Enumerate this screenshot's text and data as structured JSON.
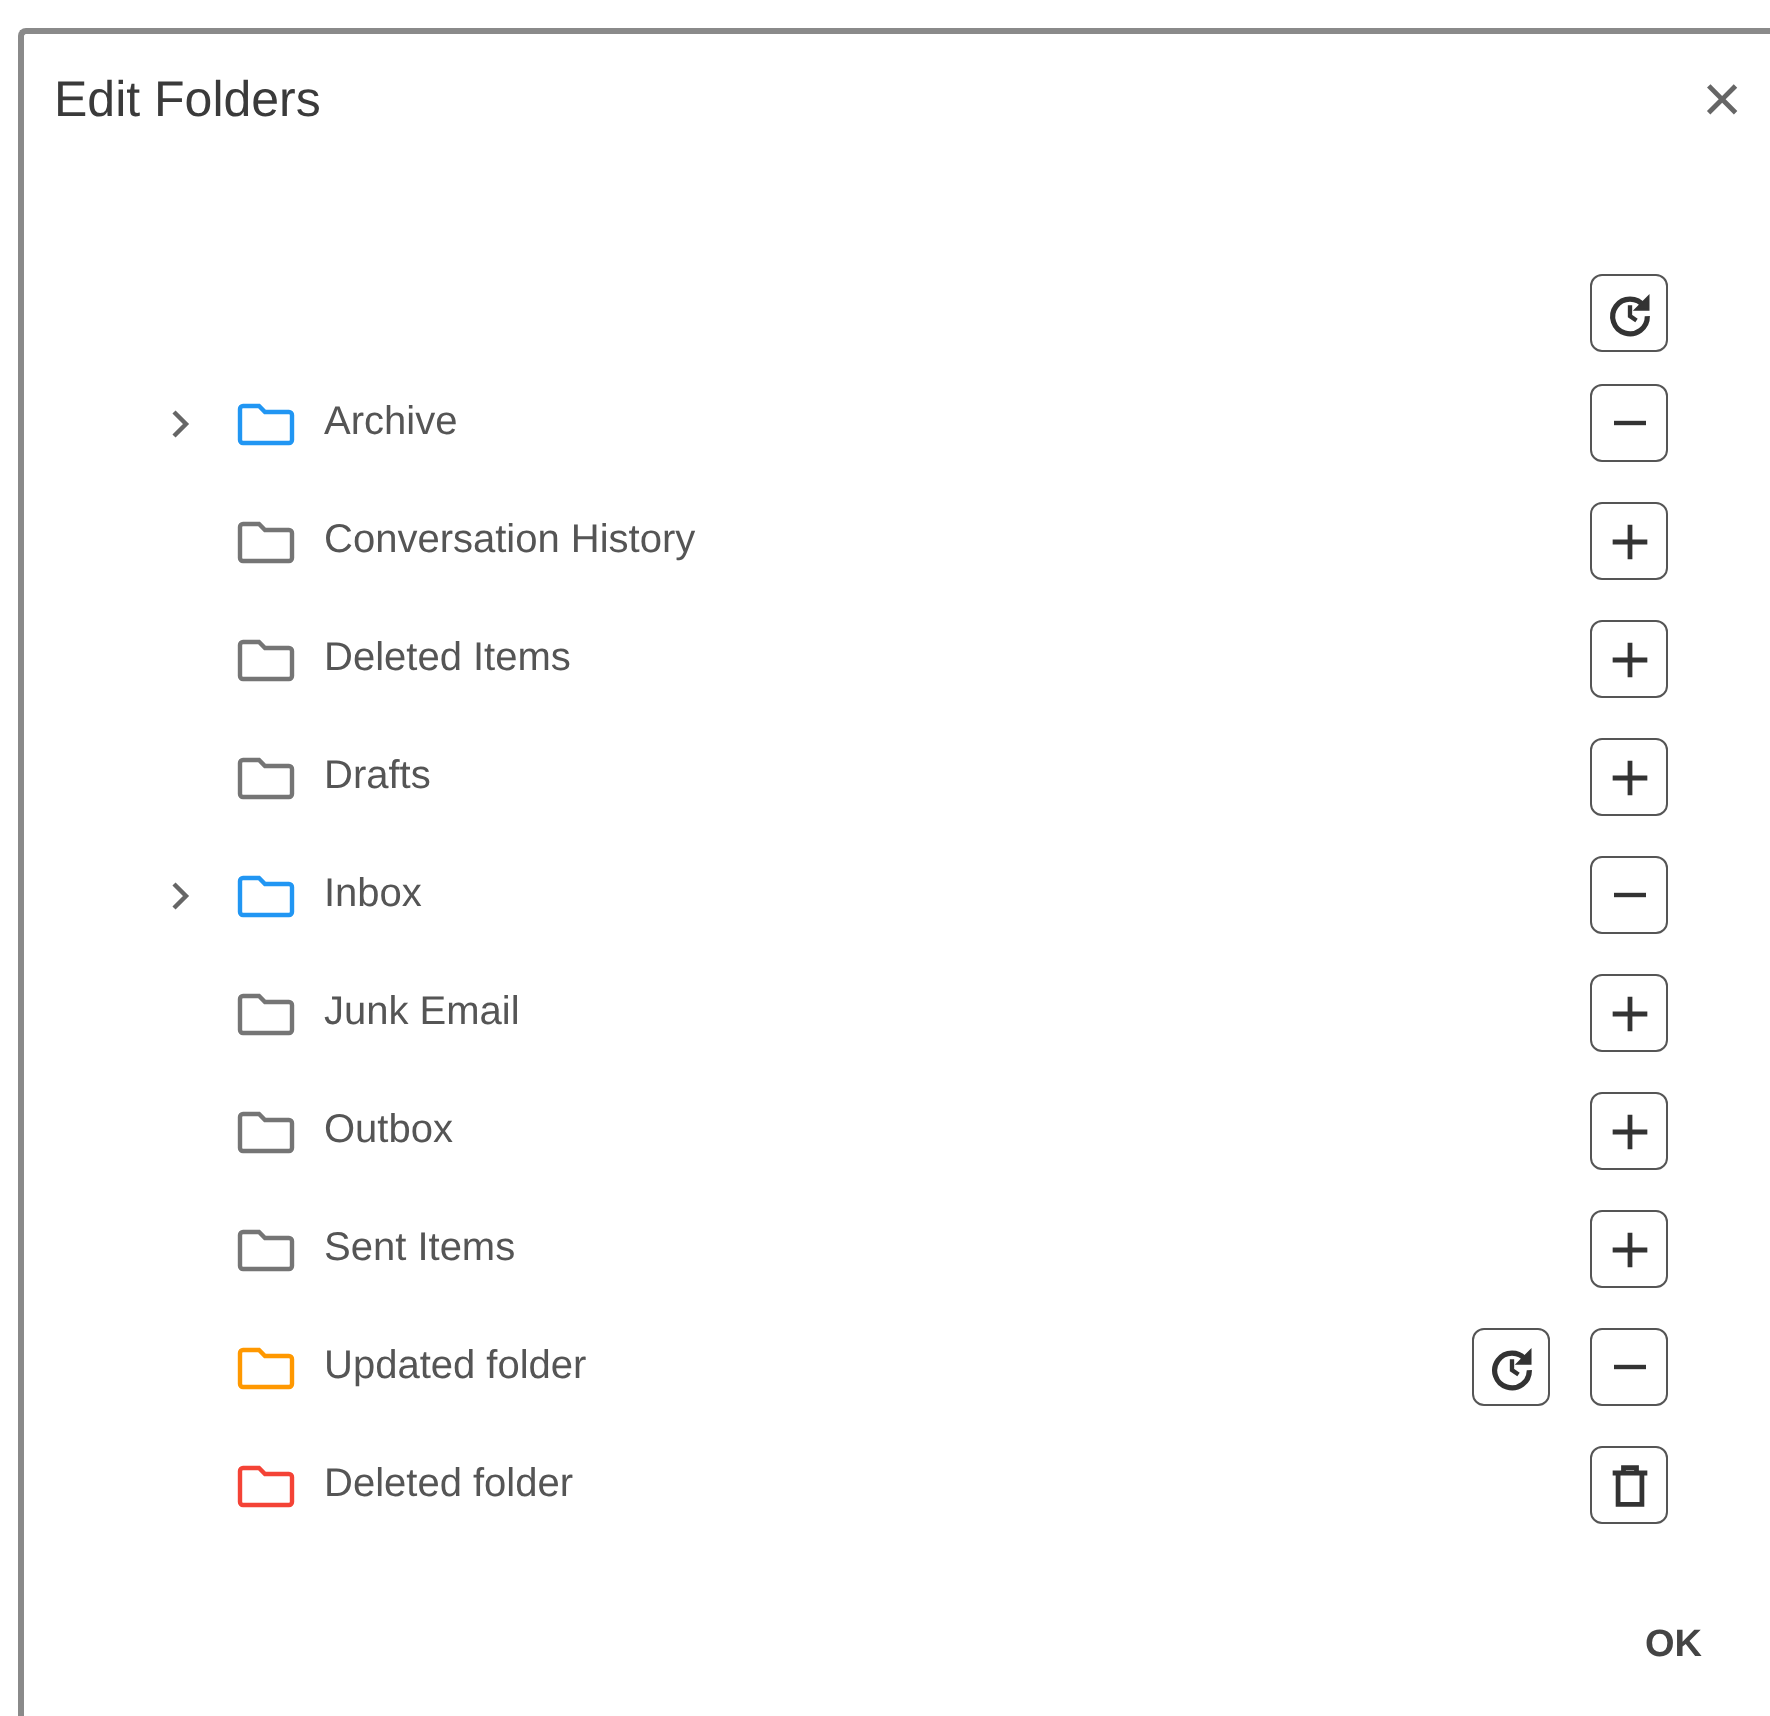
{
  "dialog": {
    "title": "Edit Folders",
    "close": "×",
    "top_actions": [
      {
        "kind": "reset"
      }
    ],
    "folders": [
      {
        "name": "Archive",
        "color": "#2196f3",
        "expandable": true,
        "actions": [
          {
            "kind": "remove"
          }
        ]
      },
      {
        "name": "Conversation History",
        "color": "#757575",
        "expandable": false,
        "actions": [
          {
            "kind": "add"
          }
        ]
      },
      {
        "name": "Deleted Items",
        "color": "#757575",
        "expandable": false,
        "actions": [
          {
            "kind": "add"
          }
        ]
      },
      {
        "name": "Drafts",
        "color": "#757575",
        "expandable": false,
        "actions": [
          {
            "kind": "add"
          }
        ]
      },
      {
        "name": "Inbox",
        "color": "#2196f3",
        "expandable": true,
        "actions": [
          {
            "kind": "remove"
          }
        ]
      },
      {
        "name": "Junk Email",
        "color": "#757575",
        "expandable": false,
        "actions": [
          {
            "kind": "add"
          }
        ]
      },
      {
        "name": "Outbox",
        "color": "#757575",
        "expandable": false,
        "actions": [
          {
            "kind": "add"
          }
        ]
      },
      {
        "name": "Sent Items",
        "color": "#757575",
        "expandable": false,
        "actions": [
          {
            "kind": "add"
          }
        ]
      },
      {
        "name": "Updated folder",
        "color": "#ff9800",
        "expandable": false,
        "actions": [
          {
            "kind": "reset"
          },
          {
            "kind": "remove"
          }
        ]
      },
      {
        "name": "Deleted folder",
        "color": "#f44336",
        "expandable": false,
        "actions": [
          {
            "kind": "delete"
          }
        ]
      }
    ],
    "buttons": [
      "OK"
    ]
  }
}
